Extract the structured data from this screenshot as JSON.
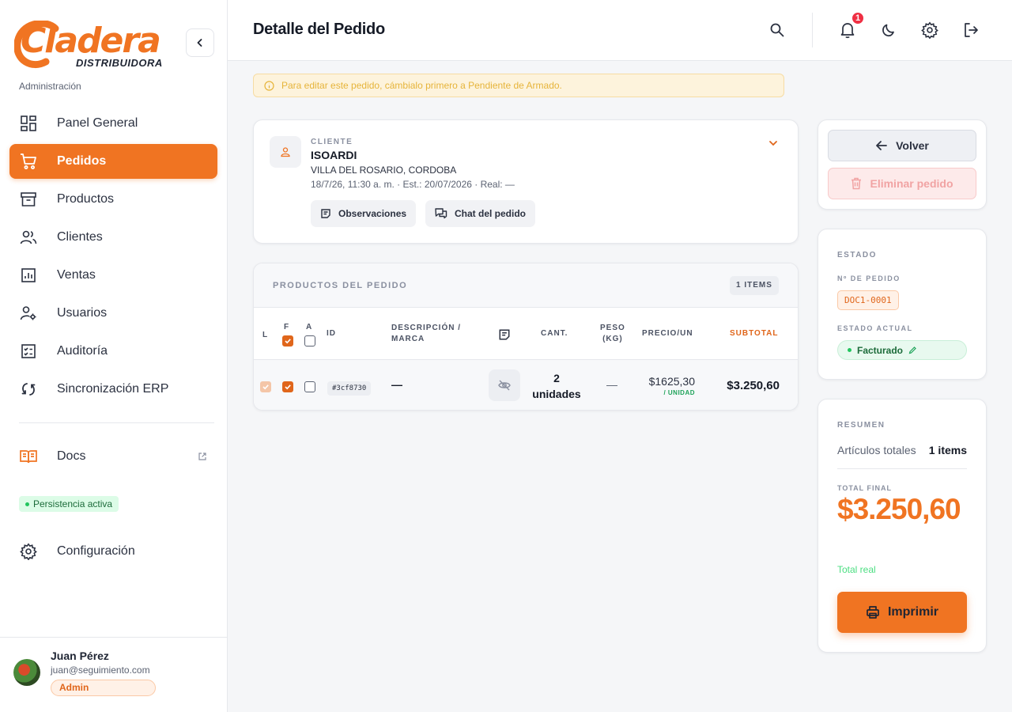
{
  "brand": {
    "logo_main": "Cladera",
    "logo_sub": "DISTRIBUIDORA",
    "accent": "#f07422"
  },
  "sidebar": {
    "section_label": "Administración",
    "items": [
      {
        "label": "Panel General",
        "icon": "dashboard-icon"
      },
      {
        "label": "Pedidos",
        "icon": "cart-icon",
        "active": true
      },
      {
        "label": "Productos",
        "icon": "archive-icon"
      },
      {
        "label": "Clientes",
        "icon": "users-icon"
      },
      {
        "label": "Ventas",
        "icon": "chart-icon"
      },
      {
        "label": "Usuarios",
        "icon": "user-cog-icon"
      },
      {
        "label": "Auditoría",
        "icon": "audit-icon"
      },
      {
        "label": "Sincronización ERP",
        "icon": "sync-icon"
      }
    ],
    "docs_label": "Docs",
    "persistence": "Persistencia activa",
    "config_label": "Configuración",
    "user": {
      "name": "Juan Pérez",
      "email": "juan@seguimiento.com",
      "role": "Admin"
    }
  },
  "header": {
    "title": "Detalle del Pedido",
    "notifications": "1"
  },
  "alert": "Para editar este pedido, cámbialo primero a Pendiente de Armado.",
  "client": {
    "label": "CLIENTE",
    "name": "ISOARDI",
    "location": "VILLA DEL ROSARIO, CORDOBA",
    "dates": "18/7/26, 11:30 a. m. · Est.: 20/07/2026 · Real: —",
    "observations_label": "Observaciones",
    "chat_label": "Chat del pedido"
  },
  "products": {
    "title": "PRODUCTOS DEL PEDIDO",
    "count": "1 ITEMS",
    "headers": {
      "l": "L",
      "f": "F",
      "a": "A",
      "id": "ID",
      "desc_1": "DESCRIPCIÓN /",
      "desc_2": "MARCA",
      "qty": "CANT.",
      "weight_1": "PESO",
      "weight_2": "(KG)",
      "price": "PRECIO/UN",
      "subtotal": "SUBTOTAL"
    },
    "rows": [
      {
        "id": "#3cf8730",
        "description": "—",
        "qty_1": "2",
        "qty_2": "unidades",
        "weight": "—",
        "price": "$1625,30",
        "price_unit": "/ UNIDAD",
        "subtotal": "$3.250,60"
      }
    ]
  },
  "actions": {
    "back": "Volver",
    "delete": "Eliminar pedido"
  },
  "status": {
    "title": "ESTADO",
    "order_label": "Nº DE PEDIDO",
    "order_number": "DOC1-0001",
    "state_label": "ESTADO ACTUAL",
    "state": "Facturado"
  },
  "summary": {
    "title": "RESUMEN",
    "items_label": "Artículos totales",
    "items_value": "1 items",
    "total_label": "TOTAL FINAL",
    "total": "$3.250,60",
    "total_note": "Total real",
    "print": "Imprimir"
  }
}
